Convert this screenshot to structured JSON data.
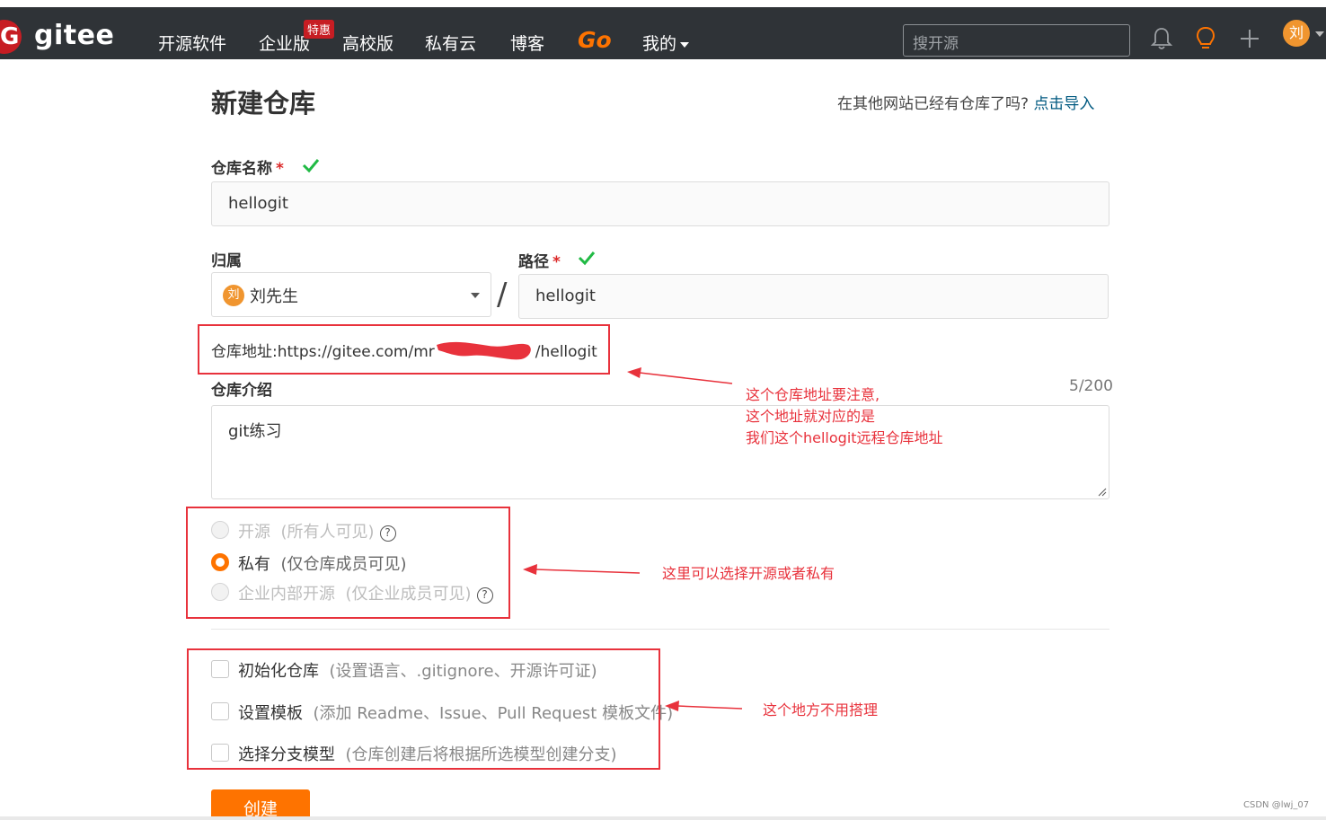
{
  "header": {
    "logo_letter": "G",
    "logo_text": "gitee",
    "nav": [
      {
        "label": "开源软件"
      },
      {
        "label": "企业版"
      },
      {
        "label": "高校版"
      },
      {
        "label": "私有云"
      },
      {
        "label": "博客"
      }
    ],
    "promo_badge": "特惠",
    "go_label": "Go",
    "mine_label": "我的",
    "search_placeholder": "搜开源",
    "avatar_initial": "刘"
  },
  "page": {
    "title": "新建仓库",
    "import_hint": "在其他网站已经有仓库了吗?",
    "import_link": "点击导入"
  },
  "form": {
    "name_label": "仓库名称",
    "name_value": "hellogit",
    "owner_label": "归属",
    "owner_initial": "刘",
    "owner_value": "刘先生",
    "separator": "/",
    "path_label": "路径",
    "path_value": "hellogit",
    "required_mark": "*",
    "address_prefix": "仓库地址:https://gitee.com/mr",
    "address_suffix": "/hellogit",
    "intro_label": "仓库介绍",
    "intro_counter": "5/200",
    "intro_value": "git练习",
    "visibility": [
      {
        "label": "开源",
        "hint": "(所有人可见)",
        "selected": false,
        "disabled": true,
        "help": "?"
      },
      {
        "label": "私有",
        "hint": "(仅仓库成员可见)",
        "selected": true,
        "disabled": false,
        "help": ""
      },
      {
        "label": "企业内部开源",
        "hint": "(仅企业成员可见)",
        "selected": false,
        "disabled": true,
        "help": "?"
      }
    ],
    "options": [
      {
        "label": "初始化仓库",
        "hint": "(设置语言、.gitignore、开源许可证)",
        "checked": false
      },
      {
        "label": "设置模板",
        "hint": "(添加 Readme、Issue、Pull Request 模板文件)",
        "checked": false
      },
      {
        "label": "选择分支模型",
        "hint": "(仓库创建后将根据所选模型创建分支)",
        "checked": false
      }
    ],
    "create_label": "创建"
  },
  "annotations": {
    "address_note": [
      "这个仓库地址要注意,",
      "这个地址就对应的是",
      "我们这个hellogit远程仓库地址"
    ],
    "visibility_note": "这里可以选择开源或者私有",
    "options_note": "这个地方不用搭理",
    "color": "#e8323c"
  },
  "watermark": "CSDN @lwj_07",
  "colors": {
    "header_bg": "#2f3337",
    "brand_red": "#c71d23",
    "accent_orange": "#fe7300",
    "success_green": "#21ba45",
    "link_blue": "#005980"
  }
}
